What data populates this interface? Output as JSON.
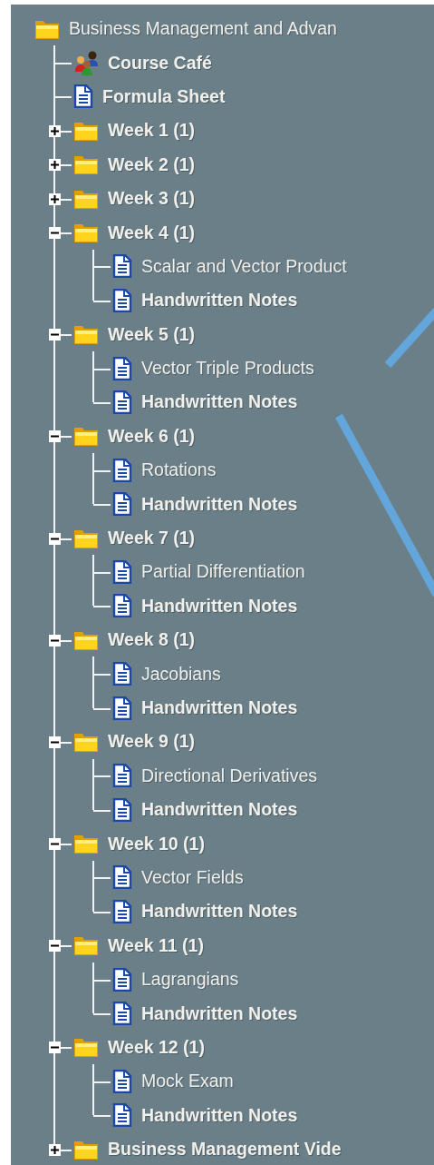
{
  "tree": {
    "label": "Business Management and Advan",
    "kind": "folder",
    "unread": false,
    "children": [
      {
        "label": "Course Café",
        "kind": "cafe",
        "unread": true
      },
      {
        "label": "Formula Sheet",
        "kind": "document",
        "unread": true
      },
      {
        "label": "Week 1 (1)",
        "kind": "folder",
        "expanded": false,
        "unread": true
      },
      {
        "label": "Week 2 (1)",
        "kind": "folder",
        "expanded": false,
        "unread": true
      },
      {
        "label": "Week 3 (1)",
        "kind": "folder",
        "expanded": false,
        "unread": true
      },
      {
        "label": "Week 4 (1)",
        "kind": "folder",
        "expanded": true,
        "unread": true,
        "children": [
          {
            "label": "Scalar and Vector Product",
            "kind": "document",
            "unread": false
          },
          {
            "label": "Handwritten Notes",
            "kind": "document",
            "unread": true
          }
        ]
      },
      {
        "label": "Week 5 (1)",
        "kind": "folder",
        "expanded": true,
        "unread": true,
        "children": [
          {
            "label": "Vector Triple Products",
            "kind": "document",
            "unread": false
          },
          {
            "label": "Handwritten Notes",
            "kind": "document",
            "unread": true
          }
        ]
      },
      {
        "label": "Week 6 (1)",
        "kind": "folder",
        "expanded": true,
        "unread": true,
        "children": [
          {
            "label": "Rotations",
            "kind": "document",
            "unread": false
          },
          {
            "label": "Handwritten Notes",
            "kind": "document",
            "unread": true
          }
        ]
      },
      {
        "label": "Week 7 (1)",
        "kind": "folder",
        "expanded": true,
        "unread": true,
        "children": [
          {
            "label": "Partial Differentiation",
            "kind": "document",
            "unread": false
          },
          {
            "label": "Handwritten Notes",
            "kind": "document",
            "unread": true
          }
        ]
      },
      {
        "label": "Week 8 (1)",
        "kind": "folder",
        "expanded": true,
        "unread": true,
        "children": [
          {
            "label": "Jacobians",
            "kind": "document",
            "unread": false
          },
          {
            "label": "Handwritten Notes",
            "kind": "document",
            "unread": true
          }
        ]
      },
      {
        "label": "Week 9 (1)",
        "kind": "folder",
        "expanded": true,
        "unread": true,
        "children": [
          {
            "label": "Directional Derivatives",
            "kind": "document",
            "unread": false
          },
          {
            "label": "Handwritten Notes",
            "kind": "document",
            "unread": true
          }
        ]
      },
      {
        "label": "Week 10 (1)",
        "kind": "folder",
        "expanded": true,
        "unread": true,
        "children": [
          {
            "label": "Vector Fields",
            "kind": "document",
            "unread": false
          },
          {
            "label": "Handwritten Notes",
            "kind": "document",
            "unread": true
          }
        ]
      },
      {
        "label": "Week 11 (1)",
        "kind": "folder",
        "expanded": true,
        "unread": true,
        "children": [
          {
            "label": "Lagrangians",
            "kind": "document",
            "unread": false
          },
          {
            "label": "Handwritten Notes",
            "kind": "document",
            "unread": true
          }
        ]
      },
      {
        "label": "Week 12 (1)",
        "kind": "folder",
        "expanded": true,
        "unread": true,
        "children": [
          {
            "label": "Mock Exam",
            "kind": "document",
            "unread": false
          },
          {
            "label": "Handwritten Notes",
            "kind": "document",
            "unread": true
          }
        ]
      },
      {
        "label": "Business Management Vide",
        "kind": "folder",
        "expanded": false,
        "unread": true
      }
    ]
  }
}
